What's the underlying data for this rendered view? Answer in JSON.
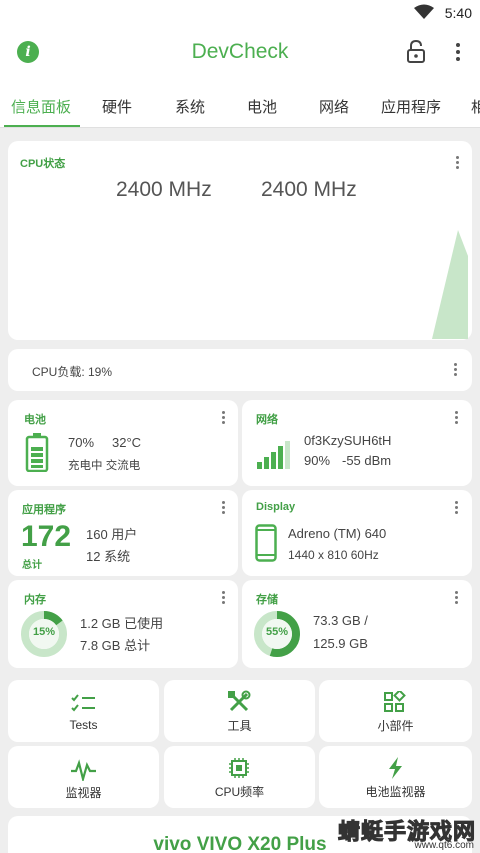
{
  "status_bar": {
    "time": "5:40",
    "wifi_icon": "wifi-icon"
  },
  "app_bar": {
    "title": "DevCheck",
    "info_icon": "i",
    "lock_icon": "lock-icon",
    "menu_icon": "more-vert-icon"
  },
  "tabs": [
    {
      "label": "信息面板",
      "active": true
    },
    {
      "label": "硬件",
      "active": false
    },
    {
      "label": "系统",
      "active": false
    },
    {
      "label": "电池",
      "active": false
    },
    {
      "label": "网络",
      "active": false
    },
    {
      "label": "应用程序",
      "active": false
    },
    {
      "label": "相",
      "active": false
    }
  ],
  "cpu_status": {
    "title": "CPU状态",
    "freq_1": "2400 MHz",
    "freq_2": "2400 MHz"
  },
  "cpu_load": {
    "label": "CPU负载: 19%"
  },
  "battery": {
    "title": "电池",
    "level": "70%",
    "temp": "32°C",
    "status": "充电中 交流电",
    "level_fraction": 0.7
  },
  "network": {
    "title": "网络",
    "ssid": "0f3KzySUH6tH",
    "signal": "90%",
    "dbm": "-55 dBm"
  },
  "apps": {
    "title": "应用程序",
    "count": "172",
    "total_label": "总计",
    "user_apps": "160 用户",
    "system_apps": "12 系统"
  },
  "display": {
    "title": "Display",
    "gpu": "Adreno (TM) 640",
    "resolution": "1440 x 810  60Hz"
  },
  "memory": {
    "title": "内存",
    "percent_label": "15%",
    "percent": 15,
    "used": "1.2 GB 已使用",
    "total": "7.8 GB 总计"
  },
  "storage": {
    "title": "存储",
    "percent_label": "55%",
    "percent": 55,
    "used": "73.3 GB /",
    "total": "125.9 GB"
  },
  "tools": [
    {
      "label": "Tests",
      "icon": "checklist-icon"
    },
    {
      "label": "工具",
      "icon": "tools-icon"
    },
    {
      "label": "小部件",
      "icon": "widgets-icon"
    },
    {
      "label": "监视器",
      "icon": "pulse-icon"
    },
    {
      "label": "CPU频率",
      "icon": "chip-icon"
    },
    {
      "label": "电池监视器",
      "icon": "bolt-icon"
    }
  ],
  "device": {
    "model": "vivo VIVO X20 Plus"
  },
  "watermark": {
    "text": "蜻蜓手游戏网",
    "url": "www.qt6.com"
  },
  "colors": {
    "accent": "#4caf50",
    "accent_dark": "#43a047",
    "ring_track": "#c8e6c9",
    "background": "#eeeeee"
  }
}
